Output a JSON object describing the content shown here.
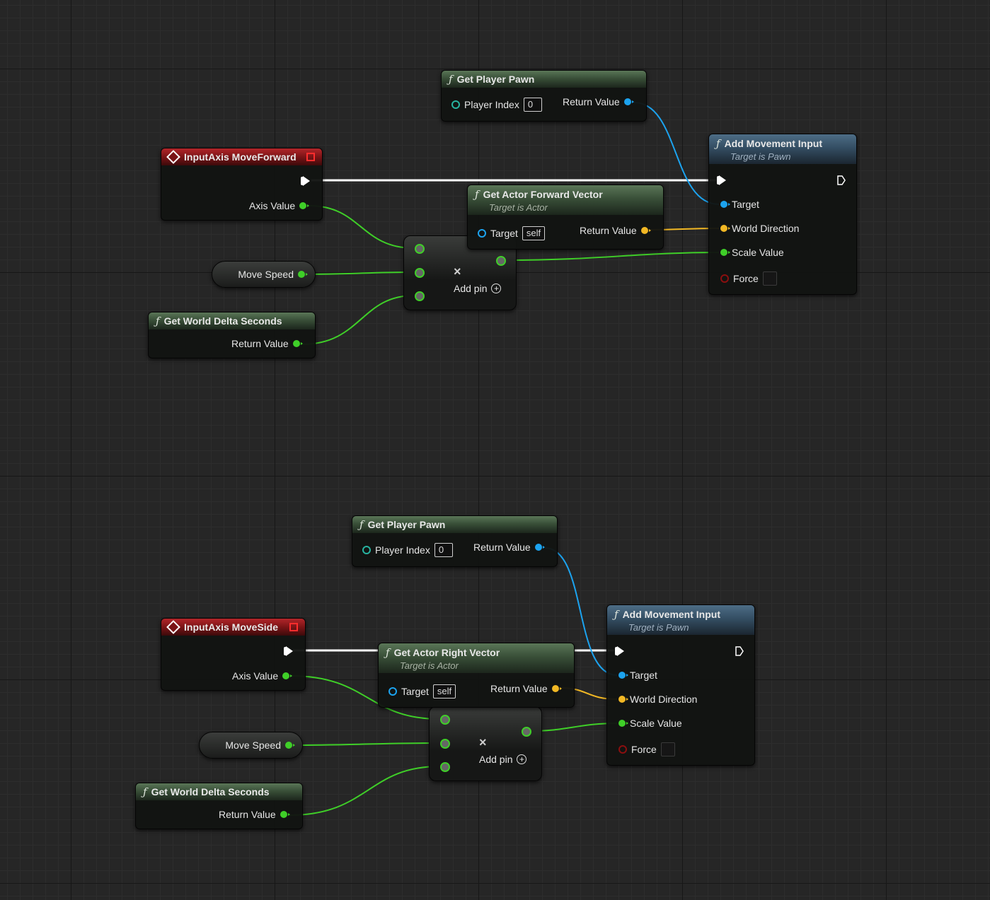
{
  "colors": {
    "float": "#3fcf28",
    "object": "#1ca3ef",
    "vector": "#f2b824",
    "exec": "#ffffff",
    "event_header": "#b3262a",
    "function_header": "#394f38",
    "target_header": "#344e63"
  },
  "icons": {
    "function": "function-f-icon",
    "event": "event-diamond-icon",
    "delegate": "delegate-square-icon",
    "multiply": "multiply-x-icon",
    "add_pin": "plus-circle-icon"
  },
  "group1": {
    "get_pawn": {
      "title": "Get Player Pawn",
      "player_index_label": "Player Index",
      "player_index_value": "0",
      "return_label": "Return Value"
    },
    "input_axis": {
      "title": "InputAxis MoveForward",
      "axis_label": "Axis Value"
    },
    "move_speed": {
      "label": "Move Speed"
    },
    "delta": {
      "title": "Get World Delta Seconds",
      "return_label": "Return Value"
    },
    "vector": {
      "title": "Get Actor Forward Vector",
      "subtitle": "Target is Actor",
      "target_label": "Target",
      "target_value": "self",
      "return_label": "Return Value"
    },
    "multiply": {
      "symbol": "×",
      "add_pin_label": "Add pin"
    },
    "add_movement": {
      "title": "Add Movement Input",
      "subtitle": "Target is Pawn",
      "target_label": "Target",
      "world_direction_label": "World Direction",
      "scale_label": "Scale Value",
      "force_label": "Force"
    }
  },
  "group2": {
    "get_pawn": {
      "title": "Get Player Pawn",
      "player_index_label": "Player Index",
      "player_index_value": "0",
      "return_label": "Return Value"
    },
    "input_axis": {
      "title": "InputAxis MoveSide",
      "axis_label": "Axis Value"
    },
    "move_speed": {
      "label": "Move Speed"
    },
    "delta": {
      "title": "Get World Delta Seconds",
      "return_label": "Return Value"
    },
    "vector": {
      "title": "Get Actor Right Vector",
      "subtitle": "Target is Actor",
      "target_label": "Target",
      "target_value": "self",
      "return_label": "Return Value"
    },
    "multiply": {
      "symbol": "×",
      "add_pin_label": "Add pin"
    },
    "add_movement": {
      "title": "Add Movement Input",
      "subtitle": "Target is Pawn",
      "target_label": "Target",
      "world_direction_label": "World Direction",
      "scale_label": "Scale Value",
      "force_label": "Force"
    }
  }
}
